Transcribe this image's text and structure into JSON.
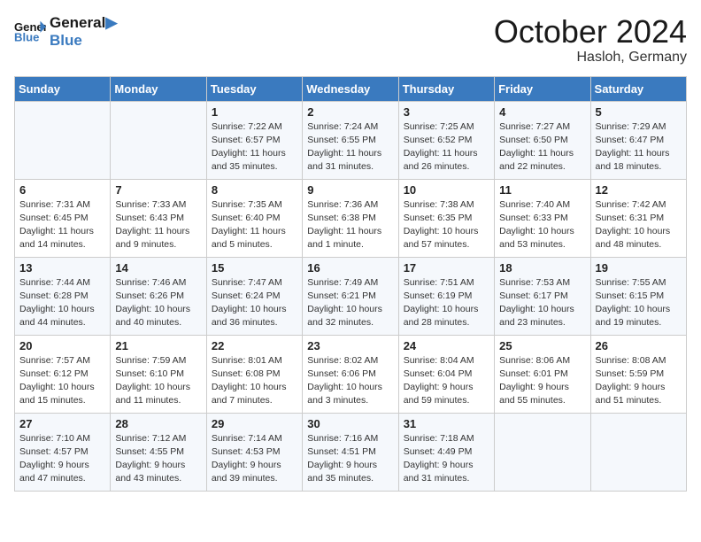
{
  "header": {
    "logo_line1": "General",
    "logo_line2": "Blue",
    "month_title": "October 2024",
    "location": "Hasloh, Germany"
  },
  "days_of_week": [
    "Sunday",
    "Monday",
    "Tuesday",
    "Wednesday",
    "Thursday",
    "Friday",
    "Saturday"
  ],
  "weeks": [
    [
      {
        "day": "",
        "info": ""
      },
      {
        "day": "",
        "info": ""
      },
      {
        "day": "1",
        "info": "Sunrise: 7:22 AM\nSunset: 6:57 PM\nDaylight: 11 hours\nand 35 minutes."
      },
      {
        "day": "2",
        "info": "Sunrise: 7:24 AM\nSunset: 6:55 PM\nDaylight: 11 hours\nand 31 minutes."
      },
      {
        "day": "3",
        "info": "Sunrise: 7:25 AM\nSunset: 6:52 PM\nDaylight: 11 hours\nand 26 minutes."
      },
      {
        "day": "4",
        "info": "Sunrise: 7:27 AM\nSunset: 6:50 PM\nDaylight: 11 hours\nand 22 minutes."
      },
      {
        "day": "5",
        "info": "Sunrise: 7:29 AM\nSunset: 6:47 PM\nDaylight: 11 hours\nand 18 minutes."
      }
    ],
    [
      {
        "day": "6",
        "info": "Sunrise: 7:31 AM\nSunset: 6:45 PM\nDaylight: 11 hours\nand 14 minutes."
      },
      {
        "day": "7",
        "info": "Sunrise: 7:33 AM\nSunset: 6:43 PM\nDaylight: 11 hours\nand 9 minutes."
      },
      {
        "day": "8",
        "info": "Sunrise: 7:35 AM\nSunset: 6:40 PM\nDaylight: 11 hours\nand 5 minutes."
      },
      {
        "day": "9",
        "info": "Sunrise: 7:36 AM\nSunset: 6:38 PM\nDaylight: 11 hours\nand 1 minute."
      },
      {
        "day": "10",
        "info": "Sunrise: 7:38 AM\nSunset: 6:35 PM\nDaylight: 10 hours\nand 57 minutes."
      },
      {
        "day": "11",
        "info": "Sunrise: 7:40 AM\nSunset: 6:33 PM\nDaylight: 10 hours\nand 53 minutes."
      },
      {
        "day": "12",
        "info": "Sunrise: 7:42 AM\nSunset: 6:31 PM\nDaylight: 10 hours\nand 48 minutes."
      }
    ],
    [
      {
        "day": "13",
        "info": "Sunrise: 7:44 AM\nSunset: 6:28 PM\nDaylight: 10 hours\nand 44 minutes."
      },
      {
        "day": "14",
        "info": "Sunrise: 7:46 AM\nSunset: 6:26 PM\nDaylight: 10 hours\nand 40 minutes."
      },
      {
        "day": "15",
        "info": "Sunrise: 7:47 AM\nSunset: 6:24 PM\nDaylight: 10 hours\nand 36 minutes."
      },
      {
        "day": "16",
        "info": "Sunrise: 7:49 AM\nSunset: 6:21 PM\nDaylight: 10 hours\nand 32 minutes."
      },
      {
        "day": "17",
        "info": "Sunrise: 7:51 AM\nSunset: 6:19 PM\nDaylight: 10 hours\nand 28 minutes."
      },
      {
        "day": "18",
        "info": "Sunrise: 7:53 AM\nSunset: 6:17 PM\nDaylight: 10 hours\nand 23 minutes."
      },
      {
        "day": "19",
        "info": "Sunrise: 7:55 AM\nSunset: 6:15 PM\nDaylight: 10 hours\nand 19 minutes."
      }
    ],
    [
      {
        "day": "20",
        "info": "Sunrise: 7:57 AM\nSunset: 6:12 PM\nDaylight: 10 hours\nand 15 minutes."
      },
      {
        "day": "21",
        "info": "Sunrise: 7:59 AM\nSunset: 6:10 PM\nDaylight: 10 hours\nand 11 minutes."
      },
      {
        "day": "22",
        "info": "Sunrise: 8:01 AM\nSunset: 6:08 PM\nDaylight: 10 hours\nand 7 minutes."
      },
      {
        "day": "23",
        "info": "Sunrise: 8:02 AM\nSunset: 6:06 PM\nDaylight: 10 hours\nand 3 minutes."
      },
      {
        "day": "24",
        "info": "Sunrise: 8:04 AM\nSunset: 6:04 PM\nDaylight: 9 hours\nand 59 minutes."
      },
      {
        "day": "25",
        "info": "Sunrise: 8:06 AM\nSunset: 6:01 PM\nDaylight: 9 hours\nand 55 minutes."
      },
      {
        "day": "26",
        "info": "Sunrise: 8:08 AM\nSunset: 5:59 PM\nDaylight: 9 hours\nand 51 minutes."
      }
    ],
    [
      {
        "day": "27",
        "info": "Sunrise: 7:10 AM\nSunset: 4:57 PM\nDaylight: 9 hours\nand 47 minutes."
      },
      {
        "day": "28",
        "info": "Sunrise: 7:12 AM\nSunset: 4:55 PM\nDaylight: 9 hours\nand 43 minutes."
      },
      {
        "day": "29",
        "info": "Sunrise: 7:14 AM\nSunset: 4:53 PM\nDaylight: 9 hours\nand 39 minutes."
      },
      {
        "day": "30",
        "info": "Sunrise: 7:16 AM\nSunset: 4:51 PM\nDaylight: 9 hours\nand 35 minutes."
      },
      {
        "day": "31",
        "info": "Sunrise: 7:18 AM\nSunset: 4:49 PM\nDaylight: 9 hours\nand 31 minutes."
      },
      {
        "day": "",
        "info": ""
      },
      {
        "day": "",
        "info": ""
      }
    ]
  ]
}
